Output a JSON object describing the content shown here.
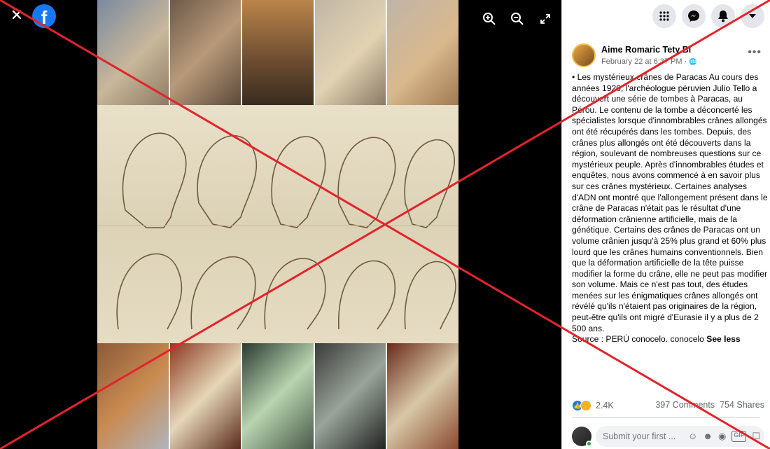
{
  "viewer": {
    "close_label": "✕",
    "logo_letter": "f",
    "tools": [
      {
        "icon": "zoom-in-icon",
        "glyph": "⊕"
      },
      {
        "icon": "zoom-out-icon",
        "glyph": "⊖"
      },
      {
        "icon": "fullscreen-icon",
        "glyph": "⤢"
      }
    ]
  },
  "topbar": {
    "buttons": [
      {
        "icon": "menu-grid-icon",
        "glyph": "⋮⋮⋮"
      },
      {
        "icon": "messenger-icon",
        "glyph": "✉"
      },
      {
        "icon": "notifications-icon",
        "glyph": "🔔"
      },
      {
        "icon": "account-dropdown-icon",
        "glyph": "▼"
      }
    ]
  },
  "post": {
    "author": "Aime Romaric Tety Bi",
    "date": "February 22 at 6:37 PM · ",
    "privacy_glyph": "🌐",
    "more_glyph": "•••",
    "text": "• Les mystérieux crânes de Paracas Au cours des années 1920, l'archéologue péruvien Julio Tello a découvert une série de tombes à Paracas, au Pérou. Le contenu de la tombe a déconcerté les spécialistes lorsque d'innombrables crânes allongés ont été récupérés dans les tombes. Depuis, des crânes plus allongés ont été découverts dans la région, soulevant de nombreuses questions sur ce mystérieux peuple. Après d'innombrables études et enquêtes, nous avons commencé à en savoir plus sur ces crânes mystérieux. Certaines analyses d'ADN ont montré que l'allongement présent dans le crâne de Paracas n'était pas le résultat d'une déformation crânienne artificielle, mais de la génétique. Certains des crânes de Paracas ont un volume crânien jusqu'à 25% plus grand et 60% plus lourd que les crânes humains conventionnels. Bien que la déformation artificielle de la tête puisse modifier la forme du crâne, elle ne peut pas modifier son volume. Mais ce n'est pas tout, des études menées sur les énigmatiques crânes allongés ont révélé qu'ils n'étaient pas originaires de la région, peut-être qu'ils ont migré d'Eurasie il y a plus de 2 500 ans.",
    "source": "Source : PERÚ conocelo. conocelo ",
    "see_less": "See less"
  },
  "stats": {
    "reactions_count": "2.4K",
    "comments": "397 Comments",
    "shares": "754 Shares"
  },
  "comment": {
    "placeholder": "Submit your first ..."
  },
  "colors": {
    "facebook_blue": "#1877f2",
    "x_mark": "#e3242b"
  }
}
